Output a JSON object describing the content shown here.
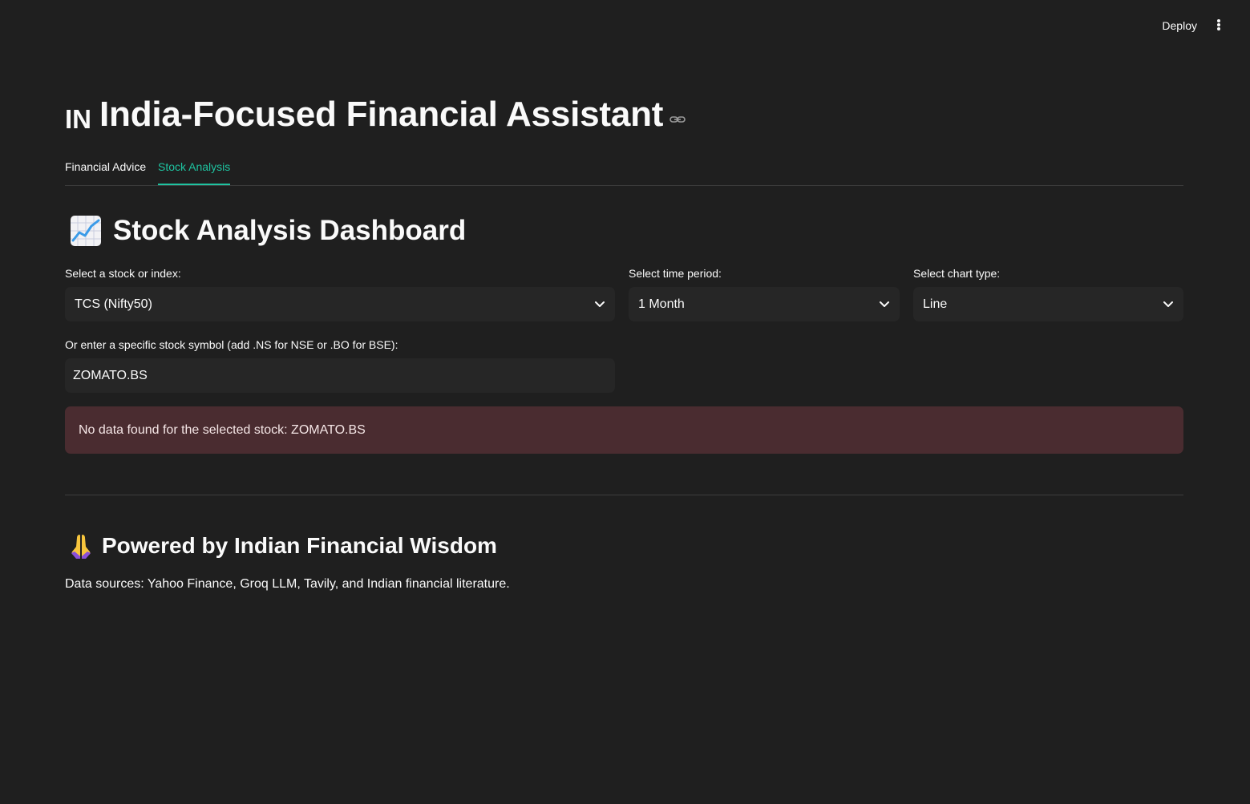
{
  "header": {
    "deploy_label": "Deploy",
    "menu_icon": "kebab-menu-icon"
  },
  "page": {
    "flag_text": "IN",
    "title": "India-Focused Financial Assistant",
    "link_icon": "link-icon"
  },
  "tabs": [
    {
      "label": "Financial Advice",
      "active": false
    },
    {
      "label": "Stock Analysis",
      "active": true
    }
  ],
  "dashboard": {
    "icon": "chart-increasing-icon",
    "title": "Stock Analysis Dashboard",
    "stock_select": {
      "label": "Select a stock or index:",
      "value": "TCS (Nifty50)"
    },
    "period_select": {
      "label": "Select time period:",
      "value": "1 Month"
    },
    "chart_type_select": {
      "label": "Select chart type:",
      "value": "Line"
    },
    "symbol_input": {
      "label": "Or enter a specific stock symbol (add .NS for NSE or .BO for BSE):",
      "value": "ZOMATO.BS"
    },
    "error_message": "No data found for the selected stock: ZOMATO.BS"
  },
  "footer": {
    "icon": "folded-hands-icon",
    "title": "Powered by Indian Financial Wisdom",
    "sources": "Data sources: Yahoo Finance, Groq LLM, Tavily, and Indian financial literature."
  },
  "colors": {
    "background": "#1f1f1f",
    "accent": "#1ec3a0",
    "input_bg": "#262626",
    "error_bg": "#4a2c30"
  }
}
